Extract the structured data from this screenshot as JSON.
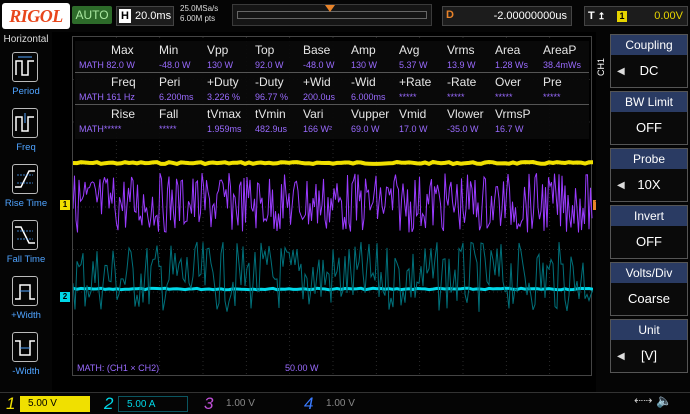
{
  "top": {
    "logo": "RIGOL",
    "mode": "AUTO",
    "horizontal_label": "H",
    "timebase": "20.0ms",
    "sample_rate": "25.0MSa/s",
    "mem_depth": "6.00M pts",
    "delay_label": "D",
    "delay_value": "-2.00000000us",
    "trigger_label": "T",
    "trigger_source": "1",
    "trigger_level": "0.00V"
  },
  "left": {
    "title": "Horizontal",
    "items": [
      {
        "label": "Period",
        "icon": "period-icon"
      },
      {
        "label": "Freq",
        "icon": "frequency-icon"
      },
      {
        "label": "Rise Time",
        "icon": "rise-time-icon"
      },
      {
        "label": "Fall Time",
        "icon": "fall-time-icon"
      },
      {
        "label": "+Width",
        "icon": "positive-width-icon"
      },
      {
        "label": "-Width",
        "icon": "negative-width-icon"
      }
    ]
  },
  "measurements": {
    "row1_headers": [
      "Max",
      "Min",
      "Vpp",
      "Top",
      "Base",
      "Amp",
      "Avg",
      "Vrms",
      "Area",
      "AreaP"
    ],
    "row1_values": [
      "MATH 82.0 W",
      "-48.0 W",
      "130 W",
      "92.0 W",
      "-48.0 W",
      "130 W",
      "5.37 W",
      "13.9 W",
      "1.28 Ws",
      "38.4mWs"
    ],
    "row2_headers": [
      "Freq",
      "Peri",
      "+Duty",
      "-Duty",
      "+Wid",
      "-Wid",
      "+Rate",
      "-Rate",
      "Over",
      "Pre"
    ],
    "row2_values": [
      "MATH 161 Hz",
      "6.200ms",
      "3.226 %",
      "96.77 %",
      "200.0us",
      "6.000ms",
      "*****",
      "*****",
      "*****",
      "*****"
    ],
    "row3_headers": [
      "Rise",
      "Fall",
      "tVmax",
      "tVmin",
      "Vari",
      "Vupper",
      "Vmid",
      "Vlower",
      "VrmsP"
    ],
    "row3_values": [
      "MATH*****",
      "*****",
      "1.959ms",
      "482.9us",
      "166 W²",
      "69.0 W",
      "17.0 W",
      "-35.0 W",
      "16.7 W"
    ]
  },
  "screen": {
    "math_label": "MATH: (CH1 × CH2)",
    "math_scale": "50.00 W",
    "ch1_marker": "1",
    "ch2_marker": "2",
    "trigger_marker": "T"
  },
  "right": {
    "channel": "CH1",
    "menu": [
      {
        "title": "Coupling",
        "value": "DC",
        "has_arrow": true
      },
      {
        "title": "BW Limit",
        "value": "OFF",
        "has_arrow": false
      },
      {
        "title": "Probe",
        "value": "10X",
        "has_arrow": true
      },
      {
        "title": "Invert",
        "value": "OFF",
        "has_arrow": false
      },
      {
        "title": "Volts/Div",
        "value": "Coarse",
        "has_arrow": false
      },
      {
        "title": "Unit",
        "value": "[V]",
        "has_arrow": true
      }
    ]
  },
  "bottom": {
    "channels": [
      {
        "num": "1",
        "scale": "5.00 V",
        "color": "#f0e000"
      },
      {
        "num": "2",
        "scale": "5.00 A",
        "color": "#00d8e8"
      },
      {
        "num": "3",
        "scale": "1.00 V",
        "color": "#c04fd8"
      },
      {
        "num": "4",
        "scale": "1.00 V",
        "color": "#3a7bff"
      }
    ]
  },
  "colors": {
    "ch1": "#f0e000",
    "ch2": "#00d8e8",
    "math": "#9a3bff",
    "trigger": "#e8832a",
    "menu_header": "#2a3b63"
  }
}
